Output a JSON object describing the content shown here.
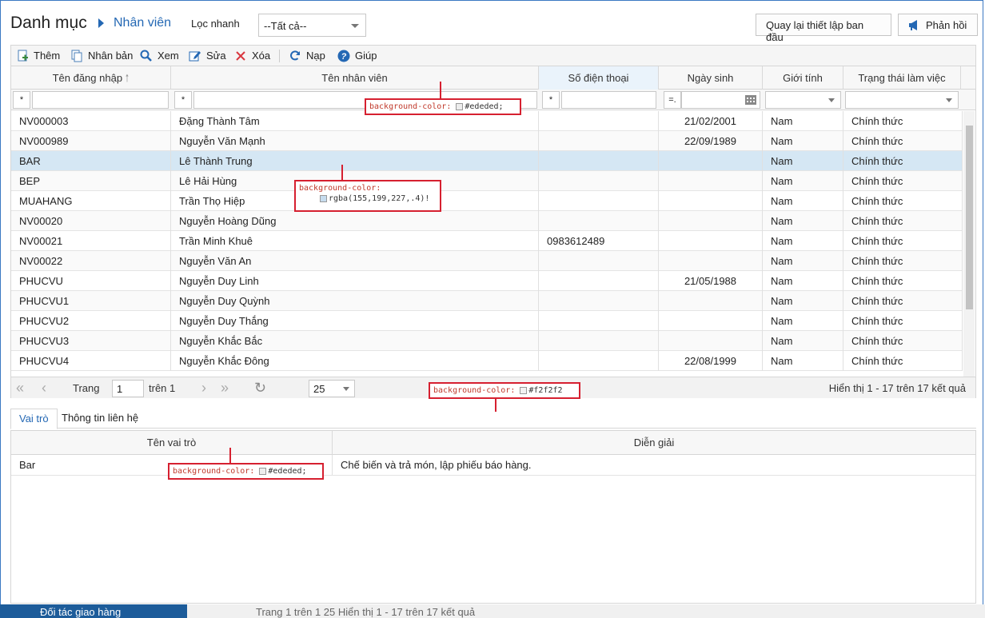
{
  "header": {
    "title": "Danh mục",
    "crumb": "Nhân viên",
    "quick_filter_label": "Lọc nhanh",
    "quick_filter_value": "--Tất cả--",
    "reset_button": "Quay lại thiết lập ban đầu",
    "feedback_button": "Phản hồi"
  },
  "toolbar": {
    "add": "Thêm",
    "duplicate": "Nhân bản",
    "view": "Xem",
    "edit": "Sửa",
    "delete": "Xóa",
    "reload": "Nạp",
    "help": "Giúp"
  },
  "grid": {
    "columns": [
      "Tên đăng nhập",
      "Tên nhân viên",
      "Số điện thoại",
      "Ngày sinh",
      "Giới tính",
      "Trạng thái làm việc"
    ],
    "filter_ops": [
      "*",
      "*",
      "*",
      "=."
    ],
    "rows": [
      [
        "NV000003",
        "Đặng Thành Tâm",
        "",
        "21/02/2001",
        "Nam",
        "Chính thức"
      ],
      [
        "NV000989",
        "Nguyễn Văn Mạnh",
        "",
        "22/09/1989",
        "Nam",
        "Chính thức"
      ],
      [
        "BAR",
        "Lê Thành Trung",
        "",
        "",
        "Nam",
        "Chính thức"
      ],
      [
        "BEP",
        "Lê Hải Hùng",
        "",
        "",
        "Nam",
        "Chính thức"
      ],
      [
        "MUAHANG",
        "Trần Thọ Hiệp",
        "",
        "",
        "Nam",
        "Chính thức"
      ],
      [
        "NV00020",
        "Nguyễn Hoàng Dũng",
        "",
        "",
        "Nam",
        "Chính thức"
      ],
      [
        "NV00021",
        "Trần Minh Khuê",
        "0983612489",
        "",
        "Nam",
        "Chính thức"
      ],
      [
        "NV00022",
        "Nguyễn Văn An",
        "",
        "",
        "Nam",
        "Chính thức"
      ],
      [
        "PHUCVU",
        "Nguyễn Duy Linh",
        "",
        "21/05/1988",
        "Nam",
        "Chính thức"
      ],
      [
        "PHUCVU1",
        "Nguyễn Duy Quỳnh",
        "",
        "",
        "Nam",
        "Chính thức"
      ],
      [
        "PHUCVU2",
        "Nguyễn Duy Thắng",
        "",
        "",
        "Nam",
        "Chính thức"
      ],
      [
        "PHUCVU3",
        "Nguyễn Khắc Bắc",
        "",
        "",
        "Nam",
        "Chính thức"
      ],
      [
        "PHUCVU4",
        "Nguyễn Khắc Đông",
        "",
        "22/08/1999",
        "Nam",
        "Chính thức"
      ]
    ],
    "selected_row": 2
  },
  "pager": {
    "page_label": "Trang",
    "page_value": "1",
    "of_label": "trên 1",
    "page_size": "25",
    "summary": "Hiển thị 1 - 17 trên 17 kết quả"
  },
  "tabs": [
    "Vai trò",
    "Thông tin liên hệ"
  ],
  "subgrid": {
    "columns": [
      "Tên vai trò",
      "Diễn giải"
    ],
    "rows": [
      [
        "Bar",
        "Chế biến và trả món, lập phiếu báo hàng."
      ]
    ]
  },
  "annotations": {
    "filter_note_key": "background-color:",
    "filter_note_val": "#ededed;",
    "row_note_key": "background-color:",
    "row_note_val": "rgba(155,199,227,.4)!",
    "pager_note_key": "background-color:",
    "pager_note_val": "#f2f2f2",
    "sub_note_key": "background-color:",
    "sub_note_val": "#ededed;"
  },
  "background": {
    "side_item": "Đối tác giao hàng",
    "pager_text": "Trang 1 trên 1 25 Hiển thị 1 - 17 trên 17 kết quả"
  },
  "colors": {
    "accent": "#2468b4",
    "selected_row": "#d5e7f4",
    "annotation_border": "#d62030"
  }
}
